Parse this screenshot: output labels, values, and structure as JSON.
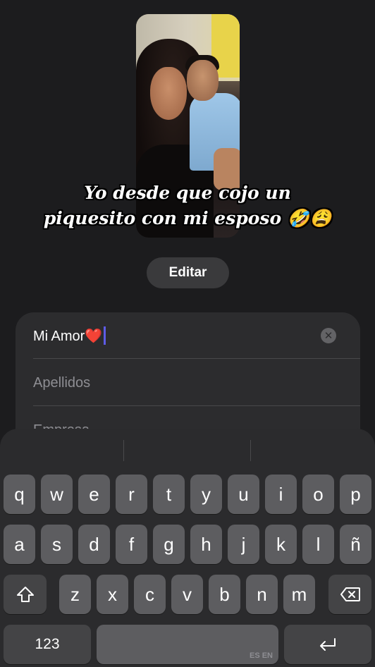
{
  "photo": {
    "caption_line1": "Yo desde que cojo un",
    "caption_line2": "piquesito con mi esposo 🤣😩"
  },
  "edit_button": {
    "label": "Editar"
  },
  "form": {
    "first_name_value": "Mi Amor❤️",
    "last_name_placeholder": "Apellidos",
    "company_placeholder": "Empresa",
    "clear_icon": "xmark-circle-icon"
  },
  "keyboard": {
    "row1": [
      "q",
      "w",
      "e",
      "r",
      "t",
      "y",
      "u",
      "i",
      "o",
      "p"
    ],
    "row2": [
      "a",
      "s",
      "d",
      "f",
      "g",
      "h",
      "j",
      "k",
      "l",
      "ñ"
    ],
    "row3": [
      "z",
      "x",
      "c",
      "v",
      "b",
      "n",
      "m"
    ],
    "shift_icon": "shift-icon",
    "delete_icon": "delete-backward-icon",
    "numbers_label": "123",
    "language_hint": "ES EN",
    "return_icon": "return-icon"
  },
  "colors": {
    "background": "#1c1c1e",
    "card": "#2c2c2e",
    "key": "#5d5d60",
    "caret": "#5e5ce6"
  }
}
